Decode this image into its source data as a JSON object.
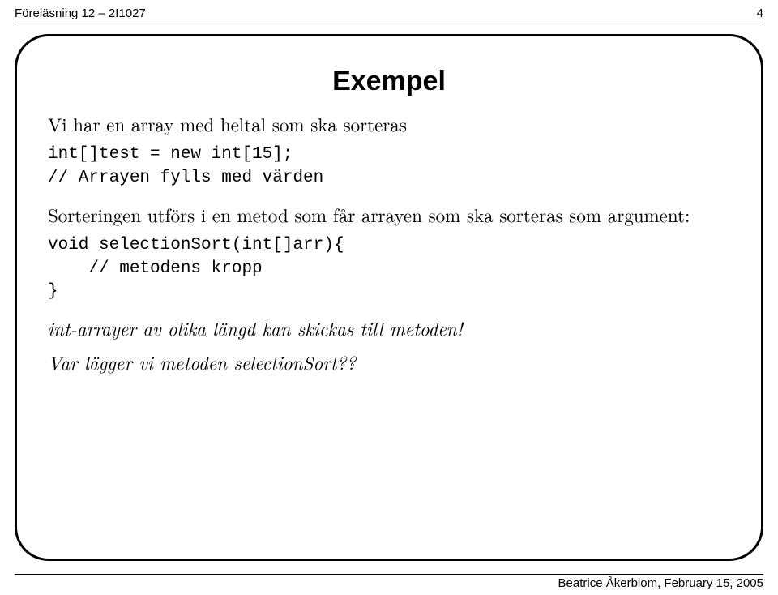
{
  "header": {
    "left": "Föreläsning 12 – 2I1027",
    "right": "4"
  },
  "slide": {
    "title": "Exempel",
    "intro_text": "Vi har en array med heltal som ska sorteras",
    "code1": "int[]test = new int[15];\n// Arrayen fylls med värden",
    "sort_text": "Sorteringen utförs i en metod som får arrayen som ska sorteras som argument:",
    "code2": "void selectionSort(int[]arr){\n    // metodens kropp\n}",
    "note1": "int-arrayer av olika längd kan skickas till metoden!",
    "note2": "Var lägger vi metoden selectionSort??"
  },
  "footer": {
    "text": "Beatrice Åkerblom, February 15, 2005"
  }
}
